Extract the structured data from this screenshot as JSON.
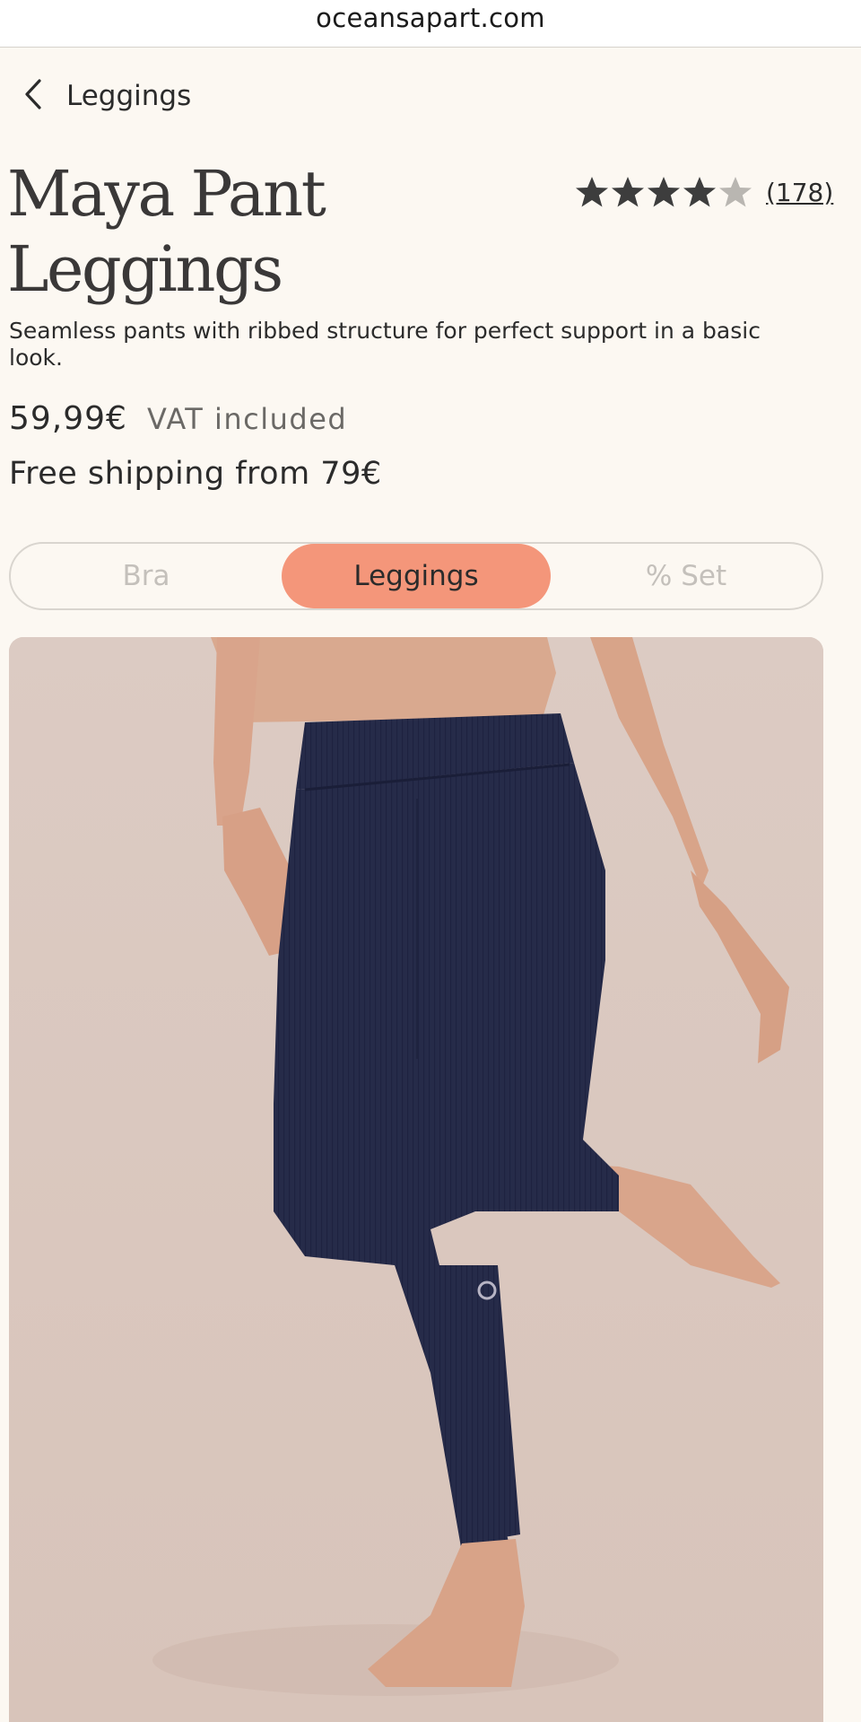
{
  "browser": {
    "url": "oceansapart.com"
  },
  "nav": {
    "back_label": "Leggings"
  },
  "product": {
    "title_line1": "Maya Pant",
    "title_line2": "Leggings",
    "rating_stars": 4,
    "rating_max": 5,
    "review_count": "(178)",
    "description": "Seamless pants with ribbed structure for perfect support in a basic look.",
    "price": "59,99€",
    "vat_note": "VAT included",
    "shipping_note": "Free shipping from 79€"
  },
  "variant_toggle": {
    "options": [
      "Bra",
      "Leggings",
      "% Set"
    ],
    "selected": "Leggings"
  },
  "colors": {
    "background": "#fcf8f2",
    "accent": "#f4967a",
    "photo_background": "#dcc9c0",
    "leggings": "#252a47"
  },
  "icons": {
    "back": "chevron-left-icon",
    "star": "star-icon"
  }
}
